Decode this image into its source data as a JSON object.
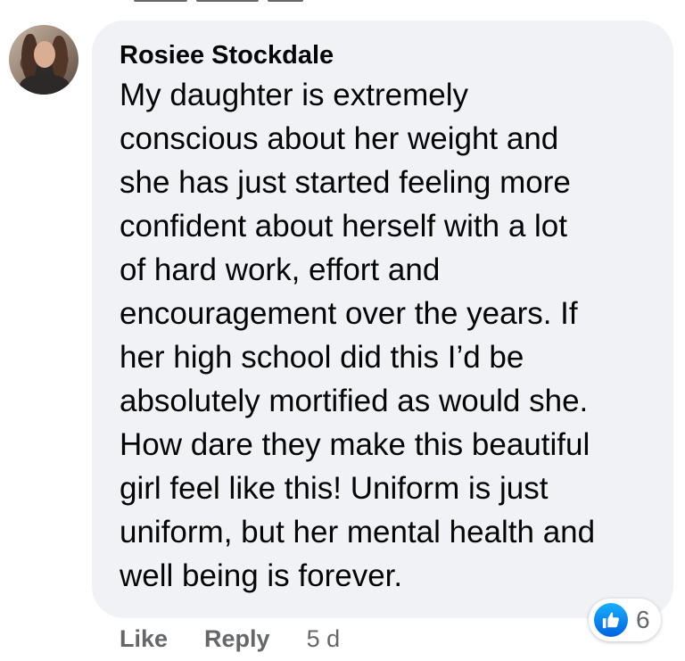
{
  "comment": {
    "author": "Rosiee Stockdale",
    "text": "My daughter is extremely conscious about her weight and she has just started feeling more confident about herself with a lot of hard work, effort and encouragement over the years. If her high school did this I’d be absolutely mortified as would she. How dare they make this beautiful girl feel like this! Uniform is just uniform, but her mental health and well being is forever.",
    "lines": [
      "My daughter is extremely",
      "conscious about her weight and",
      "she has just started feeling more",
      "confident about herself with a lot",
      "of hard work, effort and",
      "encouragement over the years. If",
      "her high school did this I’d be",
      "absolutely mortified as would she.",
      "How dare they make this beautiful",
      "girl feel like this! Uniform is just",
      "uniform, but her mental health and",
      "well being is forever."
    ],
    "avatar_icon": "profile-photo"
  },
  "actions": {
    "like_label": "Like",
    "reply_label": "Reply",
    "timestamp": "5 d"
  },
  "reactions": {
    "icon": "like-thumbs-up-icon",
    "count": "6",
    "color": "#1877f2"
  },
  "colors": {
    "bubble": "#f0f2f5",
    "text": "#050505",
    "secondary": "#65676b"
  }
}
